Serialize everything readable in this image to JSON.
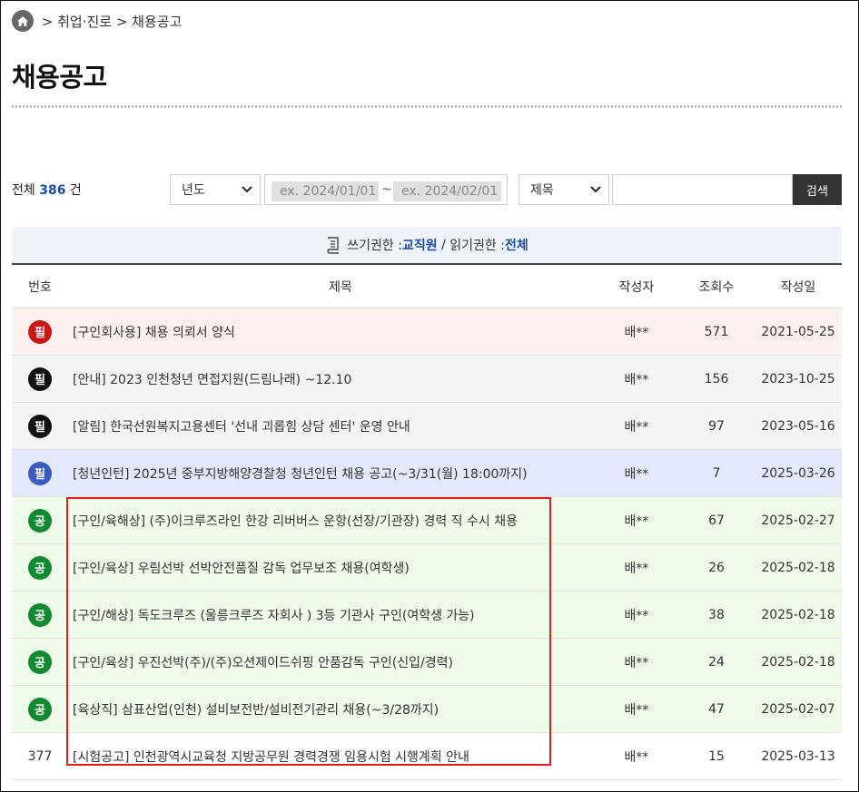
{
  "breadcrumb": {
    "home_icon": "home-icon",
    "path": " > 취업·진로 > 채용공고"
  },
  "page_title": "채용공고",
  "total": {
    "prefix": "전체 ",
    "count": "386",
    "suffix": " 건"
  },
  "filters": {
    "year_select": "년도",
    "date_from_placeholder": "ex. 2024/01/01",
    "date_sep": "~",
    "date_to_placeholder": "ex. 2024/02/01",
    "field_select": "제목",
    "search_button": "검색"
  },
  "permission": {
    "write_label": "쓰기권한 : ",
    "write_value": "교직원",
    "sep": " / ",
    "read_label": "읽기권한 : ",
    "read_value": "전체"
  },
  "columns": {
    "no": "번호",
    "title": "제목",
    "writer": "작성자",
    "views": "조회수",
    "date": "작성일"
  },
  "colors": {
    "red": "#cc1515",
    "black": "#111111",
    "blue": "#3a5cc0",
    "green": "#138a32",
    "row_pink": "#fff0f0",
    "row_gray": "#f4f4f4",
    "row_blue": "#e3e9fb",
    "row_green": "#eefbe8"
  },
  "rows": [
    {
      "no": "필",
      "title": "[구인회사용] 채용 의뢰서 양식",
      "writer": "배**",
      "views": "571",
      "date": "2021-05-25"
    },
    {
      "no": "필",
      "title": "[안내] 2023 인천청년 면접지원(드림나래) ~12.10",
      "writer": "배**",
      "views": "156",
      "date": "2023-10-25"
    },
    {
      "no": "필",
      "title": "[알림] 한국선원복지고용센터 '선내 괴롭힘 상담 센터' 운영 안내",
      "writer": "배**",
      "views": "97",
      "date": "2023-05-16"
    },
    {
      "no": "필",
      "title": "[청년인턴] 2025년 중부지방해양경찰청 청년인턴 채용 공고(~3/31(월) 18:00까지)",
      "writer": "배**",
      "views": "7",
      "date": "2025-03-26"
    },
    {
      "no": "공",
      "title": "[구인/육해상] (주)이크루즈라인 한강 리버버스 운항(선장/기관장) 경력 직 수시 채용",
      "writer": "배**",
      "views": "67",
      "date": "2025-02-27"
    },
    {
      "no": "공",
      "title": "[구인/육상] 우림선박 선박안전품질 감독 업무보조 채용(여학생)",
      "writer": "배**",
      "views": "26",
      "date": "2025-02-18"
    },
    {
      "no": "공",
      "title": "[구인/해상] 독도크루즈 (울릉크루즈 자회사 ) 3등 기관사 구인(여학생 가능)",
      "writer": "배**",
      "views": "38",
      "date": "2025-02-18"
    },
    {
      "no": "공",
      "title": "[구인/육상] 우진선박(주)/(주)오션제이드쉬핑 안품감독 구인(신입/경력)",
      "writer": "배**",
      "views": "24",
      "date": "2025-02-18"
    },
    {
      "no": "공",
      "title": "[육상직] 삼표산업(인천) 설비보전반/설비전기관리 채용(~3/28까지)",
      "writer": "배**",
      "views": "47",
      "date": "2025-02-07"
    },
    {
      "no": "377",
      "title": "[시험공고] 인천광역시교육청 지방공무원 경력경쟁 임용시험 시행계획 안내",
      "writer": "배**",
      "views": "15",
      "date": "2025-03-13"
    }
  ]
}
